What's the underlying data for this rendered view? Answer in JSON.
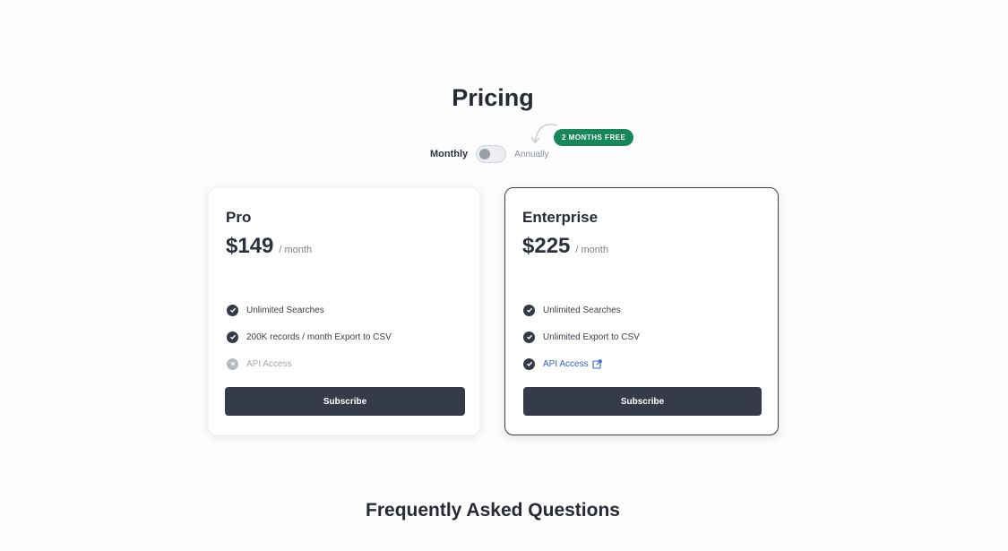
{
  "pricing": {
    "title": "Pricing",
    "toggle": {
      "monthly_label": "Monthly",
      "annually_label": "Annually",
      "selected": "Monthly"
    },
    "promo_badge": "2 MONTHS FREE"
  },
  "plans": [
    {
      "name": "Pro",
      "price": "$149",
      "period": "/ month",
      "features": [
        {
          "label": "Unlimited Searches",
          "icon": "check-circle-icon",
          "enabled": true
        },
        {
          "label": "200K records / month Export to CSV",
          "icon": "check-circle-icon",
          "enabled": true
        },
        {
          "label": "API Access",
          "icon": "x-circle-icon",
          "enabled": false
        }
      ],
      "cta": "Subscribe"
    },
    {
      "name": "Enterprise",
      "price": "$225",
      "period": "/ month",
      "features": [
        {
          "label": "Unlimited Searches",
          "icon": "check-circle-icon",
          "enabled": true
        },
        {
          "label": "Unlimited Export to CSV",
          "icon": "check-circle-icon",
          "enabled": true
        },
        {
          "label": "API Access",
          "icon": "check-circle-icon",
          "enabled": true,
          "link": true
        }
      ],
      "cta": "Subscribe"
    }
  ],
  "faq": {
    "title": "Frequently Asked Questions"
  },
  "colors": {
    "button": "#353b48",
    "badge": "#17875a",
    "link": "#2f65c7",
    "heading": "#252a35"
  }
}
